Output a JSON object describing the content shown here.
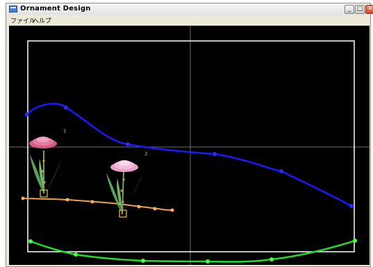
{
  "window": {
    "title": "Ornament Design"
  },
  "title_buttons": {
    "minimize": "_",
    "maximize": "□",
    "close": "✕"
  },
  "menu": {
    "file": "ファイル",
    "help": "ヘルプ"
  },
  "canvas": {
    "ornament_labels": [
      "1",
      "2"
    ],
    "colors": {
      "background": "#000000",
      "frame": "#ffffff",
      "crosshair": "#6e6e6e",
      "blue_curve": "#1a1aff",
      "orange_curve": "#f0a050",
      "green_curve": "#22dd22",
      "flower_pink": "#d85a88",
      "flower_light": "#e8a0c8",
      "leaf": "#5aa05a",
      "stem_marker": "#e0a040"
    }
  }
}
